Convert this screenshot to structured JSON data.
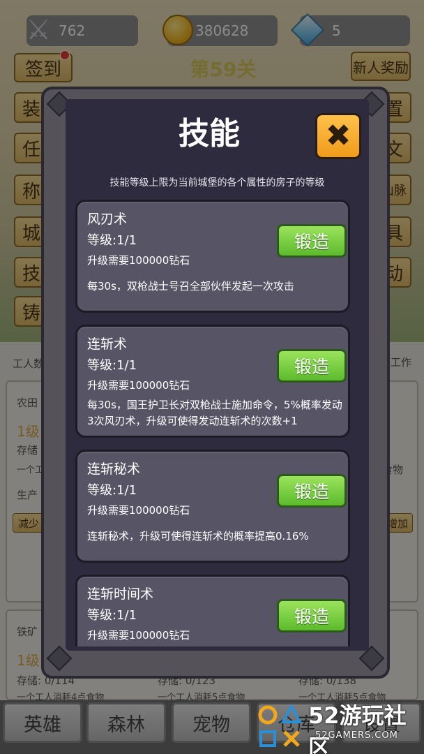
{
  "resources": {
    "swords": "762",
    "gold": "380628",
    "diamonds": "5"
  },
  "top_buttons": {
    "sign_in": "签到",
    "newbie_reward": "新人奖励"
  },
  "level_title": "第59关",
  "side_left": [
    "装",
    "任",
    "称",
    "城",
    "技",
    "铸"
  ],
  "side_right": [
    "置",
    "文",
    "山脉",
    "具",
    "动"
  ],
  "background": {
    "workers_left": "工人数",
    "workers_right": "工作",
    "card1_name": "农田",
    "card1_level": "1级",
    "card1_storage": "存储",
    "card1_consume": "一个工",
    "card1_food": "食物",
    "card1_produce": "生产",
    "decrease": "减少",
    "increase": "增加",
    "card2_name": "铁矿",
    "card2_level": "1级",
    "card2_storage": "存储: 0/114",
    "card2_storage_b": "存储: 0/123",
    "card2_storage_c": "存储: 0/138",
    "consume_a": "一个工人消耗4点食物",
    "consume_b": "一个工人消耗5点食物",
    "consume_c": "一个工人消耗5点食物"
  },
  "bottom_tabs": [
    "英雄",
    "森林",
    "宠物",
    "仓库",
    "设置"
  ],
  "modal": {
    "title": "技能",
    "subtitle": "技能等级上限为当前城堡的各个属性的房子的等级",
    "skills": [
      {
        "name": "风刃术",
        "level": "等级:1/1",
        "requirement": "升级需要100000钻石",
        "description": "每30s，双枪战士号召全部伙伴发起一次攻击",
        "button": "锻造"
      },
      {
        "name": "连斩术",
        "level": "等级:1/1",
        "requirement": "升级需要100000钻石",
        "description": "每30s，国王护卫长对双枪战士施加命令，5%概率发动3次风刃术，升级可使得发动连斩术的次数+1",
        "button": "锻造"
      },
      {
        "name": "连斩秘术",
        "level": "等级:1/1",
        "requirement": "升级需要100000钻石",
        "description": "连斩秘术，升级可使得连斩术的概率提高0.16%",
        "button": "锻造"
      },
      {
        "name": "连斩时间术",
        "level": "等级:1/1",
        "requirement": "升级需要100000钻石",
        "description": "",
        "button": "锻造"
      }
    ]
  },
  "watermark": {
    "main": "52游玩社区",
    "sub": "52GAMERS.COM"
  },
  "colors": {
    "modal_bg": "#2e2b3f",
    "card_bg": "#575466",
    "forge_green": "#5cbb2c",
    "close_orange": "#f19a1a"
  }
}
